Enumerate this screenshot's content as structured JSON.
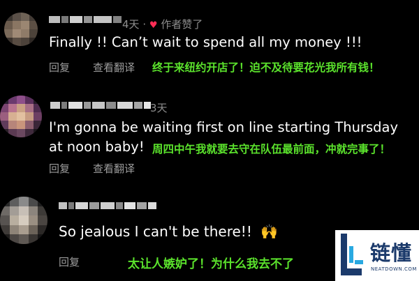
{
  "comments": [
    {
      "meta_time": "4天",
      "meta_sep": "·",
      "author_liked": "作者赞了",
      "text": "Finally !! Can’t wait to spend all my money !!!",
      "reply_label": "回复",
      "translate_label": "查看翻译",
      "translation": "终于来纽约开店了！迫不及待要花光我所有钱！"
    },
    {
      "meta_time": "3天",
      "text_line1": "I'm gonna be waiting first on line starting Thursday",
      "text_line2": "at noon baby!",
      "reply_label": "回复",
      "translate_label": "查看翻译",
      "translation": "周四中午我就要去守在队伍最前面，冲就完事了！"
    },
    {
      "text": "So jealous I can't be there!!",
      "emoji": "🙌",
      "reply_label": "回复",
      "translation": "太让人嫉妒了！为什么我去不了"
    }
  ],
  "watermark": {
    "brand_cn": "链懂",
    "brand_en": "NEATDOWN.COM",
    "colors": {
      "dark": "#1b3a6b",
      "light": "#29a9e1"
    }
  },
  "colors": {
    "background": "#000000",
    "comment_text": "#ffffff",
    "meta_text": "#8d8d8d",
    "translation_green": "#5be32c",
    "heart": "#ff2d55"
  }
}
